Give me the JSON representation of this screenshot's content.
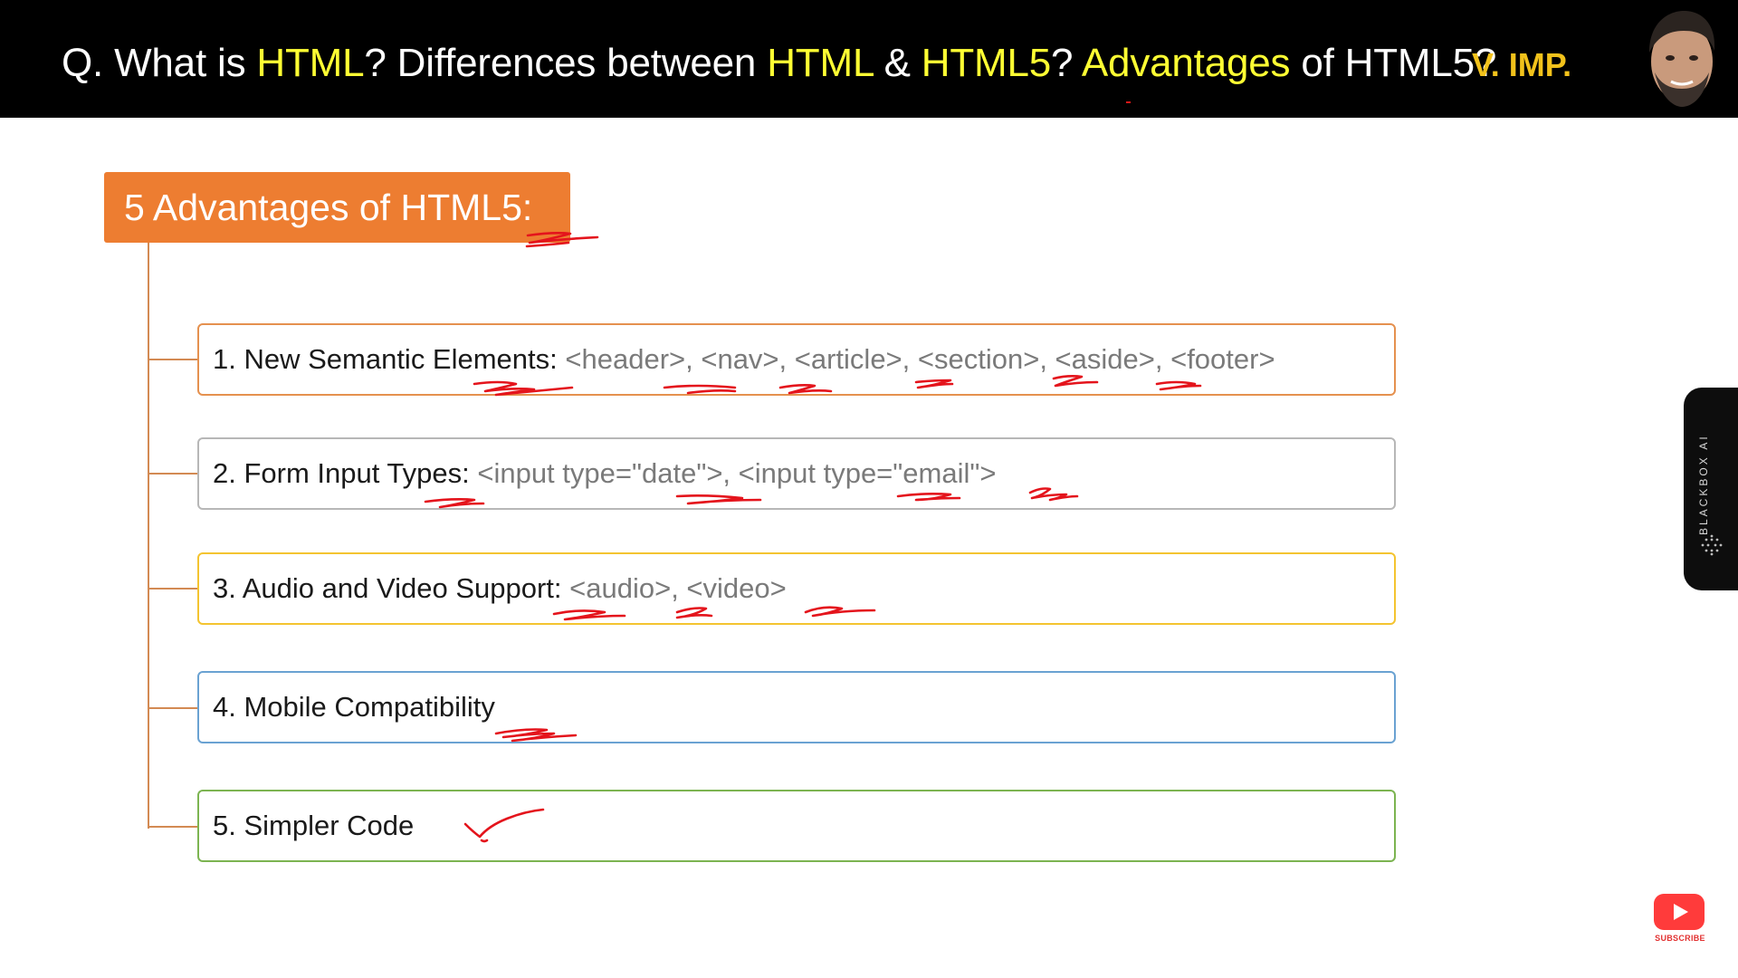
{
  "header": {
    "question": [
      {
        "text": "Q. What is ",
        "highlight": false
      },
      {
        "text": "HTML",
        "highlight": true
      },
      {
        "text": "? Differences between ",
        "highlight": false
      },
      {
        "text": "HTML",
        "highlight": true
      },
      {
        "text": " & ",
        "highlight": false
      },
      {
        "text": "HTML5",
        "highlight": true
      },
      {
        "text": "? ",
        "highlight": false
      },
      {
        "text": "Advantages",
        "highlight": true
      },
      {
        "text": " of HTML5?",
        "highlight": false
      }
    ],
    "badge": "V. IMP."
  },
  "title": "5 Advantages of HTML5:",
  "items": [
    {
      "label": "1. New Semantic Elements: ",
      "code": " <header>, <nav>, <article>, <section>, <aside>, <footer>",
      "border_color": "#e5914f"
    },
    {
      "label": "2. Form Input Types: ",
      "code": "<input type=\"date\">, <input type=\"email\">",
      "border_color": "#b7b7b7"
    },
    {
      "label": "3. Audio and Video Support: ",
      "code": " <audio>, <video>",
      "border_color": "#f4c430"
    },
    {
      "label": "4. Mobile Compatibility",
      "code": "",
      "border_color": "#6aa2d2"
    },
    {
      "label": "5. Simpler Code",
      "code": "",
      "border_color": "#7cb451"
    }
  ],
  "side_tab": {
    "label": "BLACKBOX AI",
    "icon": "blackbox-logo-icon"
  },
  "subscribe": {
    "label": "SUBSCRIBE",
    "icon": "youtube-play-icon"
  },
  "colors": {
    "highlight": "#ffff33",
    "badge": "#f2c21b",
    "title_bg": "#ed7d31",
    "ink": "#e4141c"
  }
}
